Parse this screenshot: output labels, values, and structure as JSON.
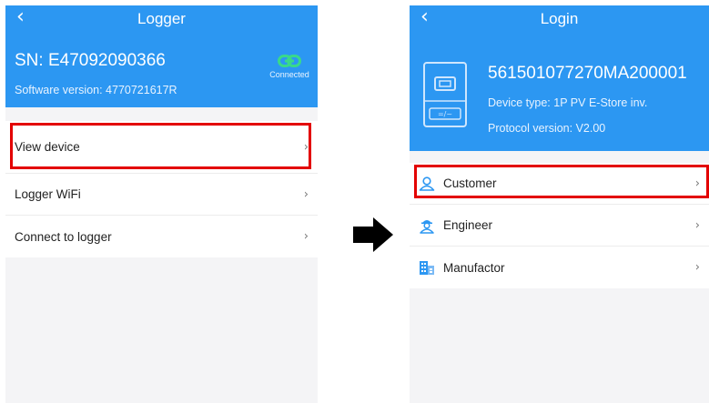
{
  "left_screen": {
    "title": "Logger",
    "back_icon": "‹",
    "serial": "SN: E47092090366",
    "software": "Software version: 4770721617R",
    "connection_status": "Connected",
    "items": [
      {
        "label": "View device"
      },
      {
        "label": "Logger WiFi"
      },
      {
        "label": "Connect to logger"
      }
    ]
  },
  "right_screen": {
    "title": "Login",
    "back_icon": "‹",
    "device_id": "561501077270MA200001",
    "device_type": "Device type: 1P PV E-Store inv.",
    "protocol": "Protocol version: V2.00",
    "items": [
      {
        "label": "Customer"
      },
      {
        "label": "Engineer"
      },
      {
        "label": "Manufactor"
      }
    ]
  },
  "chevron": "›",
  "colors": {
    "header_blue": "#2c97f2",
    "connected_green": "#39d98a",
    "highlight_red": "#e30000",
    "background": "#f4f4f6"
  }
}
